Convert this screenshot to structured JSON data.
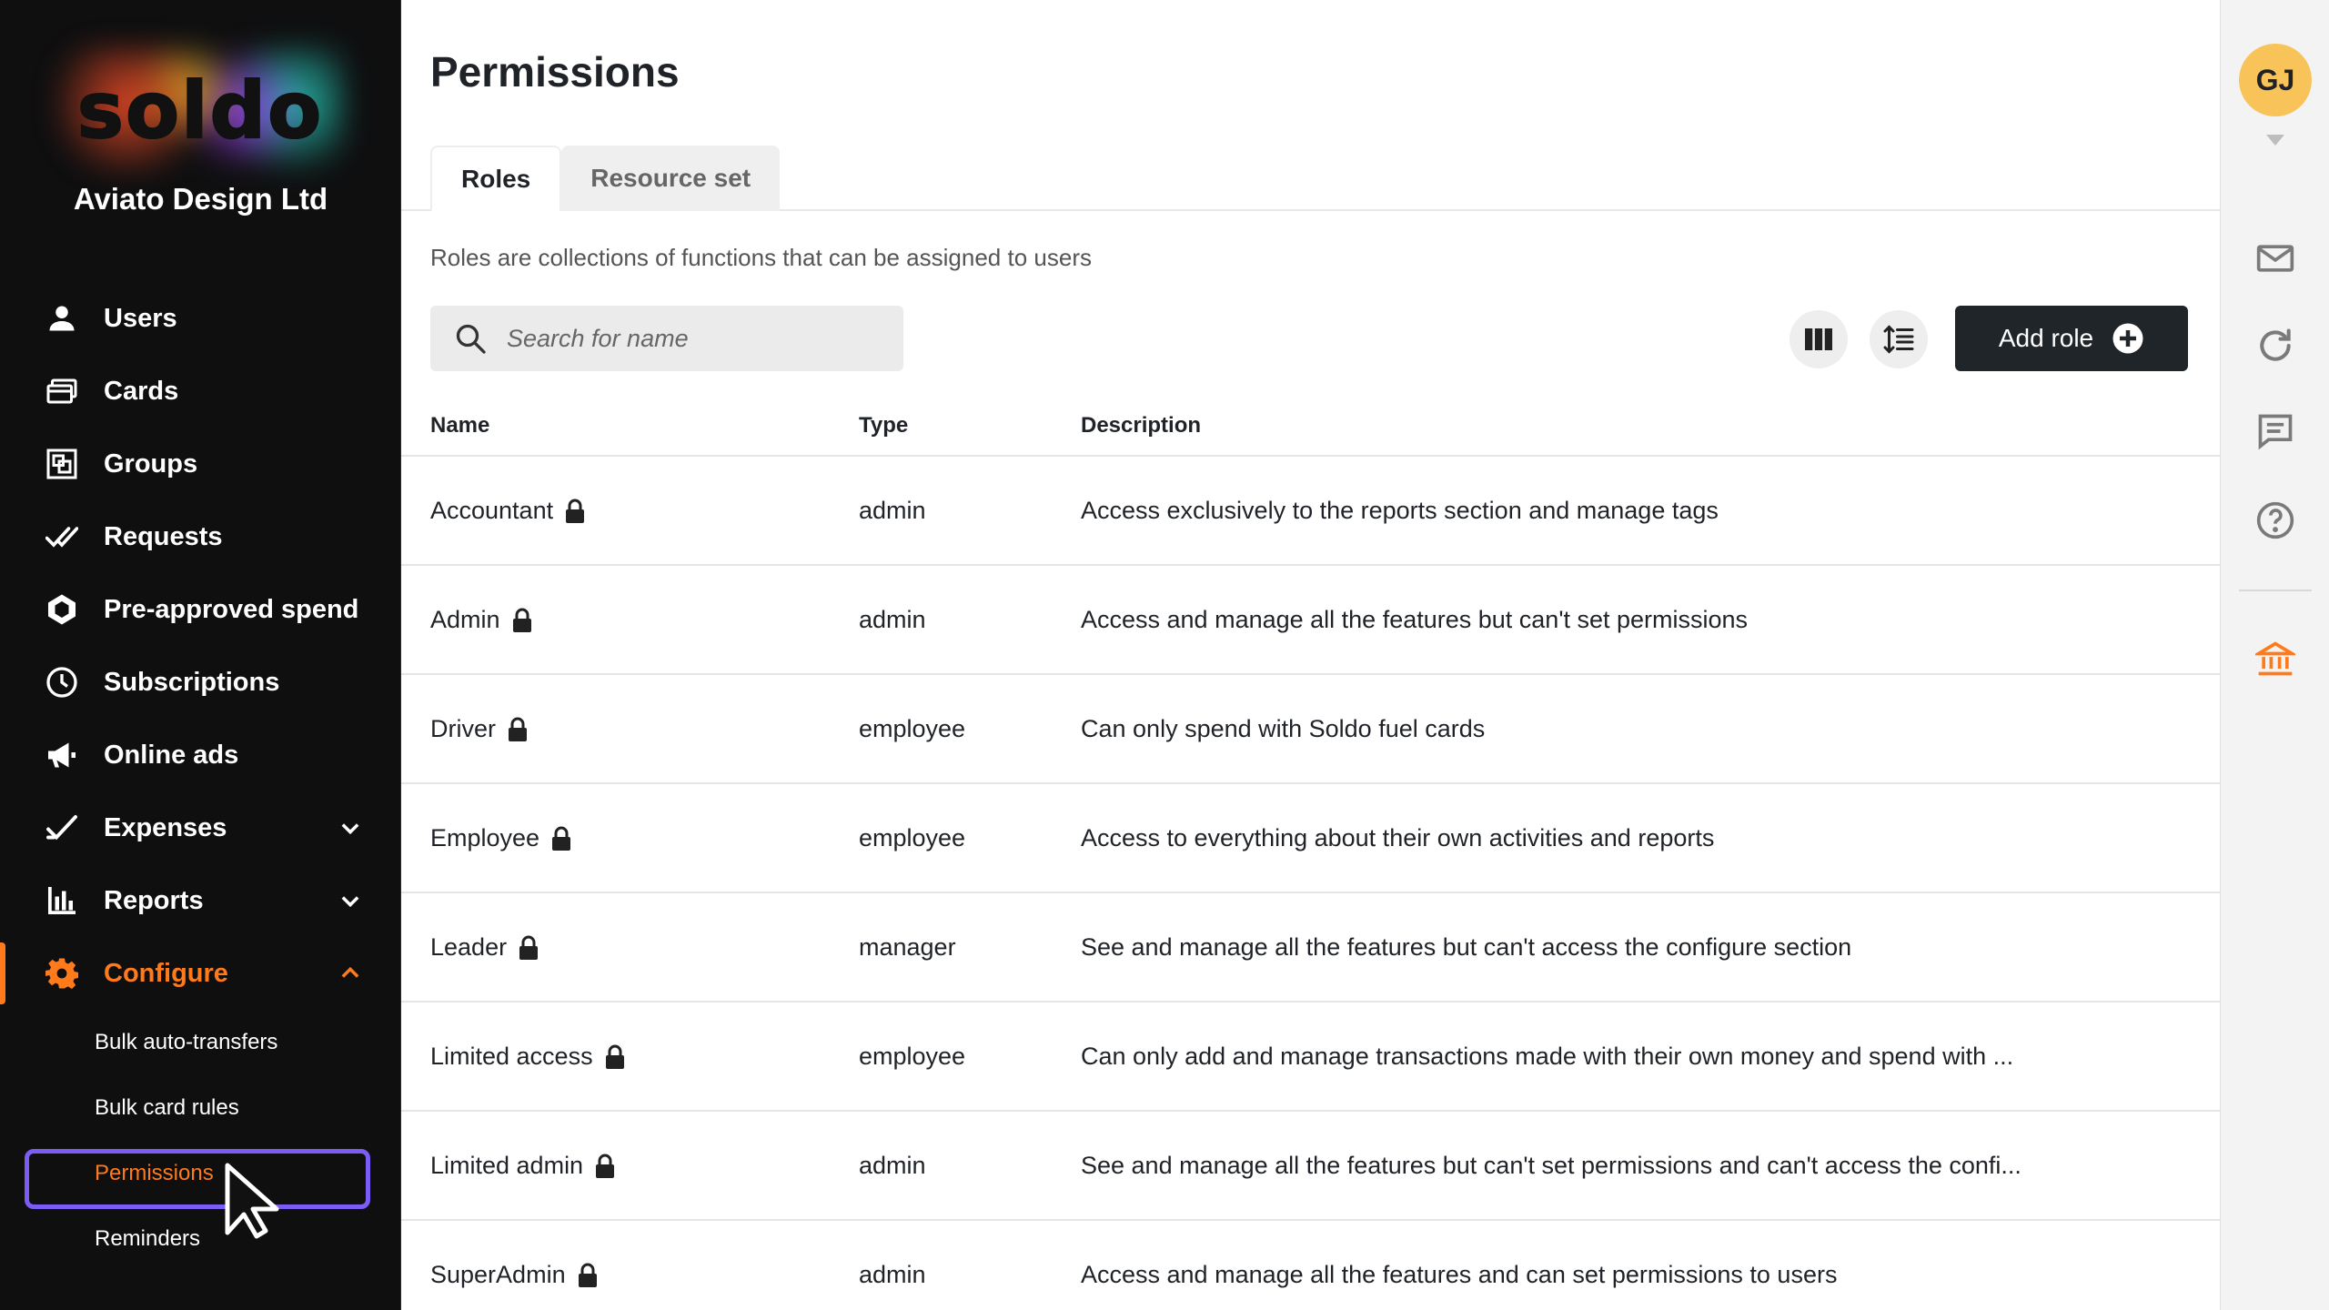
{
  "brand": {
    "logo_text": "soldo",
    "company": "Aviato Design Ltd"
  },
  "nav": {
    "users": "Users",
    "cards": "Cards",
    "groups": "Groups",
    "requests": "Requests",
    "preapproved": "Pre-approved spend",
    "subscriptions": "Subscriptions",
    "online_ads": "Online ads",
    "expenses": "Expenses",
    "reports": "Reports",
    "configure": "Configure",
    "sub": {
      "bulk_transfers": "Bulk auto-transfers",
      "bulk_card_rules": "Bulk card rules",
      "permissions": "Permissions",
      "reminders": "Reminders"
    }
  },
  "page": {
    "title": "Permissions",
    "tabs": [
      "Roles",
      "Resource set"
    ],
    "subtitle": "Roles are collections of functions that can be assigned to users",
    "search_placeholder": "Search for name",
    "add_role": "Add role"
  },
  "table": {
    "columns": {
      "name": "Name",
      "type": "Type",
      "description": "Description"
    },
    "rows": [
      {
        "name": "Accountant",
        "type": "admin",
        "description": "Access exclusively to the reports section and manage tags"
      },
      {
        "name": "Admin",
        "type": "admin",
        "description": "Access and manage all the features but can't set permissions"
      },
      {
        "name": "Driver",
        "type": "employee",
        "description": "Can only spend with Soldo fuel cards"
      },
      {
        "name": "Employee",
        "type": "employee",
        "description": "Access to everything about their own activities and reports"
      },
      {
        "name": "Leader",
        "type": "manager",
        "description": "See and manage all the features but can't access the configure section"
      },
      {
        "name": "Limited access",
        "type": "employee",
        "description": "Can only add and manage transactions made with their own money and spend with ..."
      },
      {
        "name": "Limited admin",
        "type": "admin",
        "description": "See and manage all the features but can't set permissions and can't access the confi..."
      },
      {
        "name": "SuperAdmin",
        "type": "admin",
        "description": "Access and manage all the features and can set permissions to users"
      }
    ]
  },
  "rail": {
    "avatar_initials": "GJ"
  },
  "colors": {
    "accent": "#ff7a1a",
    "highlight": "#7b5cf5",
    "avatar": "#f8c45a",
    "primary_button": "#1f2528",
    "bank_icon": "#ff7a1a"
  }
}
